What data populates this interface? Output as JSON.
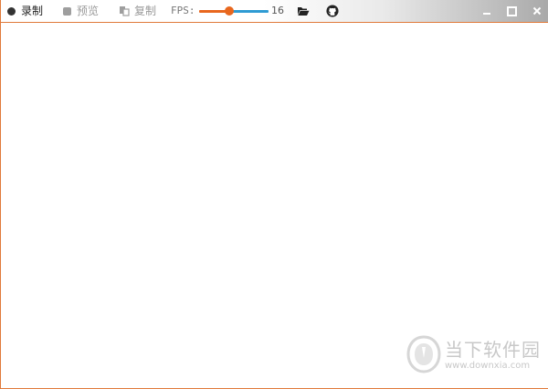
{
  "toolbar": {
    "record_label": "录制",
    "preview_label": "预览",
    "copy_label": "复制",
    "fps_label": "FPS:",
    "fps_value": "16",
    "fps_slider_fraction": 0.44,
    "folder_icon": "folder-open-icon",
    "github_icon": "github-icon"
  },
  "window_controls": {
    "minimize_icon": "minimize-icon",
    "maximize_icon": "maximize-icon",
    "close_icon": "close-icon"
  },
  "watermark": {
    "title": "当下软件园",
    "url": "www.downxia.com"
  },
  "colors": {
    "accent": "#e8671e",
    "slider_track": "#2f9bd3",
    "window_border": "#e07a3a"
  }
}
